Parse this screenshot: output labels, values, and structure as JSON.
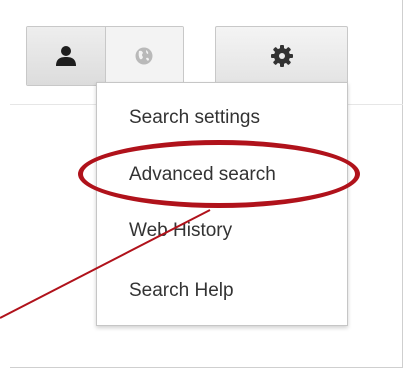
{
  "toolbar": {
    "buttons": [
      {
        "icon": "person-icon"
      },
      {
        "icon": "globe-icon"
      },
      {
        "icon": "gear-icon"
      }
    ]
  },
  "menu": {
    "items": [
      {
        "label": "Search settings"
      },
      {
        "label": "Advanced search"
      },
      {
        "label": "Web History"
      },
      {
        "label": "Search Help"
      }
    ]
  },
  "annotation": {
    "highlighted_item": "Advanced search",
    "color": "#b0121b"
  }
}
